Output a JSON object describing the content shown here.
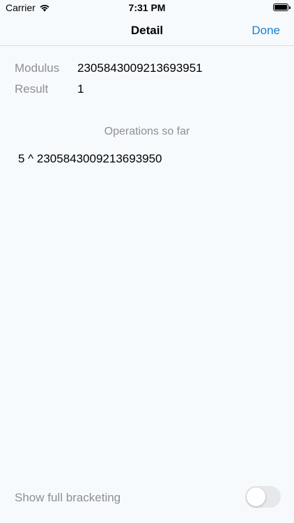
{
  "status_bar": {
    "carrier": "Carrier",
    "time": "7:31 PM",
    "wifi_icon": "wifi-icon",
    "battery_icon": "battery-icon"
  },
  "nav": {
    "title": "Detail",
    "done_label": "Done"
  },
  "info": {
    "modulus_label": "Modulus",
    "modulus_value": "2305843009213693951",
    "result_label": "Result",
    "result_value": "1"
  },
  "operations": {
    "header": "Operations so far",
    "items": [
      "5 ^ 2305843009213693950"
    ]
  },
  "bracketing": {
    "label": "Show full bracketing",
    "enabled": false
  },
  "colors": {
    "background": "#f7fafd",
    "accent": "#1a7fd0",
    "secondary_text": "#8e8e93"
  }
}
